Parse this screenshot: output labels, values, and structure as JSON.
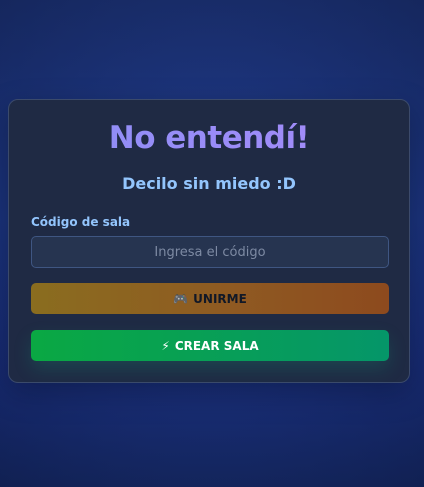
{
  "card": {
    "title": "No entendí!",
    "subtitle": "Decilo sin miedo :D"
  },
  "room_code": {
    "label": "Código de sala",
    "value": "",
    "placeholder": "Ingresa el código"
  },
  "buttons": {
    "join": {
      "icon": "🎮",
      "icon_name": "gamepad-icon",
      "label": "UNIRME"
    },
    "create": {
      "icon": "⚡",
      "icon_name": "lightning-icon",
      "label": "CREAR SALA"
    }
  },
  "colors": {
    "title_gradient_start": "#8b8ef5",
    "title_gradient_end": "#a78bfa",
    "accent_text": "#93c5fd",
    "join_button": "#8f5a22",
    "create_button": "#0aa843",
    "card_background": "#1f2a44",
    "page_background": "#1e3a8a"
  }
}
